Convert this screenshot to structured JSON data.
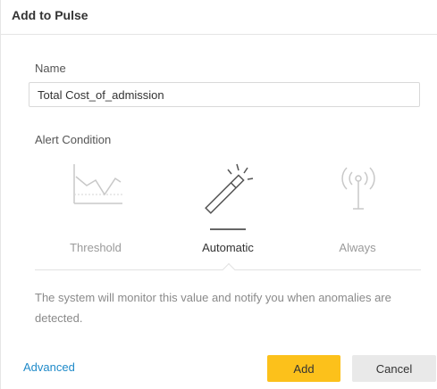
{
  "dialog": {
    "title": "Add to Pulse"
  },
  "name_field": {
    "label": "Name",
    "value": "Total Cost_of_admission"
  },
  "alert_condition": {
    "label": "Alert Condition",
    "options": [
      {
        "label": "Threshold",
        "icon": "threshold-chart-icon",
        "selected": false
      },
      {
        "label": "Automatic",
        "icon": "magic-wand-icon",
        "selected": true
      },
      {
        "label": "Always",
        "icon": "antenna-broadcast-icon",
        "selected": false
      }
    ],
    "description": "The system will monitor this value and notify you when anomalies are detected."
  },
  "footer": {
    "advanced_label": "Advanced",
    "add_label": "Add",
    "cancel_label": "Cancel"
  },
  "colors": {
    "primary_button": "#fcc11b",
    "link": "#1f8ac9",
    "secondary_button": "#e9e9e9"
  }
}
